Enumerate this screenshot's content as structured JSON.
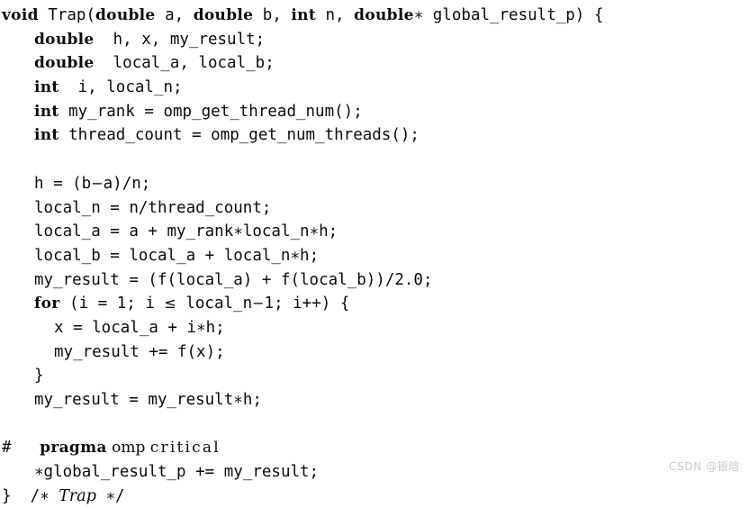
{
  "document": {
    "kind": "code-listing",
    "language": "C with OpenMP",
    "function_name": "Trap",
    "background_color": "#ffffff",
    "text_color": "#0b0b0b",
    "watermark_color": "#c8c8c8"
  },
  "watermark": {
    "text": "CSDN @银晗"
  },
  "code": {
    "lines": [
      {
        "id": "line-1",
        "indent": 0,
        "segments": [
          {
            "t": "void",
            "s": "kw"
          },
          {
            "t": " ",
            "s": "mono"
          },
          {
            "t": "Trap(",
            "s": "mono"
          },
          {
            "t": "double",
            "s": "kw"
          },
          {
            "t": " a, ",
            "s": "mono"
          },
          {
            "t": "double",
            "s": "kw"
          },
          {
            "t": " b, ",
            "s": "mono"
          },
          {
            "t": "int",
            "s": "kw"
          },
          {
            "t": " n, ",
            "s": "mono"
          },
          {
            "t": "double",
            "s": "kw"
          },
          {
            "t": "∗ global_result_p) {",
            "s": "mono"
          }
        ],
        "plain": "void Trap(double a, double b, int n, double* global_result_p) {"
      },
      {
        "id": "line-2",
        "indent": 1,
        "segments": [
          {
            "t": "double",
            "s": "kw"
          },
          {
            "t": "  h, x, my_result;",
            "s": "mono"
          }
        ],
        "plain": "double  h, x, my_result;"
      },
      {
        "id": "line-3",
        "indent": 1,
        "segments": [
          {
            "t": "double",
            "s": "kw"
          },
          {
            "t": "  local_a, local_b;",
            "s": "mono"
          }
        ],
        "plain": "double  local_a, local_b;"
      },
      {
        "id": "line-4",
        "indent": 1,
        "segments": [
          {
            "t": "int",
            "s": "kw"
          },
          {
            "t": "  i, local_n;",
            "s": "mono"
          }
        ],
        "plain": "int  i, local_n;"
      },
      {
        "id": "line-5",
        "indent": 1,
        "segments": [
          {
            "t": "int",
            "s": "kw"
          },
          {
            "t": " my_rank = omp_get_thread_num();",
            "s": "mono"
          }
        ],
        "plain": "int my_rank = omp_get_thread_num();"
      },
      {
        "id": "line-6",
        "indent": 1,
        "segments": [
          {
            "t": "int",
            "s": "kw"
          },
          {
            "t": " thread_count = omp_get_num_threads();",
            "s": "mono"
          }
        ],
        "plain": "int thread_count = omp_get_num_threads();"
      },
      {
        "id": "line-7",
        "indent": 0,
        "blank": true,
        "segments": [],
        "plain": ""
      },
      {
        "id": "line-8",
        "indent": 1,
        "segments": [
          {
            "t": "h = (b",
            "s": "mono"
          },
          {
            "t": "−",
            "s": "op"
          },
          {
            "t": "a)/n;",
            "s": "mono"
          }
        ],
        "plain": "h = (b-a)/n;"
      },
      {
        "id": "line-9",
        "indent": 1,
        "segments": [
          {
            "t": "local_n = n/thread_count;",
            "s": "mono"
          }
        ],
        "plain": "local_n = n/thread_count;"
      },
      {
        "id": "line-10",
        "indent": 1,
        "segments": [
          {
            "t": "local_a = a + my_rank",
            "s": "mono"
          },
          {
            "t": "∗",
            "s": "mono"
          },
          {
            "t": "local_n",
            "s": "mono"
          },
          {
            "t": "∗",
            "s": "mono"
          },
          {
            "t": "h;",
            "s": "mono"
          }
        ],
        "plain": "local_a = a + my_rank*local_n*h;"
      },
      {
        "id": "line-11",
        "indent": 1,
        "segments": [
          {
            "t": "local_b = local_a + local_n",
            "s": "mono"
          },
          {
            "t": "∗",
            "s": "mono"
          },
          {
            "t": "h;",
            "s": "mono"
          }
        ],
        "plain": "local_b = local_a + local_n*h;"
      },
      {
        "id": "line-12",
        "indent": 1,
        "segments": [
          {
            "t": "my_result = (f(local_a) + f(local_b))/2.0;",
            "s": "mono"
          }
        ],
        "plain": "my_result = (f(local_a) + f(local_b))/2.0;"
      },
      {
        "id": "line-13",
        "indent": 1,
        "segments": [
          {
            "t": "for",
            "s": "kw"
          },
          {
            "t": " (i = 1; i ",
            "s": "mono"
          },
          {
            "t": "≤",
            "s": "op"
          },
          {
            "t": " local_n",
            "s": "mono"
          },
          {
            "t": "−",
            "s": "op"
          },
          {
            "t": "1; i++) {",
            "s": "mono"
          }
        ],
        "plain": "for (i = 1; i <= local_n-1; i++) {"
      },
      {
        "id": "line-14",
        "indent": 2,
        "segments": [
          {
            "t": "x = local_a + i",
            "s": "mono"
          },
          {
            "t": "∗",
            "s": "mono"
          },
          {
            "t": "h;",
            "s": "mono"
          }
        ],
        "plain": "x = local_a + i*h;"
      },
      {
        "id": "line-15",
        "indent": 2,
        "segments": [
          {
            "t": "my_result += f(x);",
            "s": "mono"
          }
        ],
        "plain": "my_result += f(x);"
      },
      {
        "id": "line-16",
        "indent": 1,
        "segments": [
          {
            "t": "}",
            "s": "mono"
          }
        ],
        "plain": "}"
      },
      {
        "id": "line-17",
        "indent": 1,
        "segments": [
          {
            "t": "my_result = my_result",
            "s": "mono"
          },
          {
            "t": "∗",
            "s": "mono"
          },
          {
            "t": "h;",
            "s": "mono"
          }
        ],
        "plain": "my_result = my_result*h;"
      },
      {
        "id": "line-18",
        "indent": 0,
        "blank": true,
        "segments": [],
        "plain": ""
      },
      {
        "id": "line-19",
        "indent": 0,
        "segments": [
          {
            "t": "#",
            "s": "mono"
          },
          {
            "t": "   ",
            "s": "mono"
          },
          {
            "t": "pragma",
            "s": "kw"
          },
          {
            "t": " ",
            "s": "rm"
          },
          {
            "t": "omp",
            "s": "rm"
          },
          {
            "t": " ",
            "s": "rm"
          },
          {
            "t": "critical",
            "s": "rm-wide"
          }
        ],
        "plain": "#   pragma omp critical"
      },
      {
        "id": "line-20",
        "indent": 1,
        "segments": [
          {
            "t": "∗",
            "s": "mono"
          },
          {
            "t": "global_result_p += my_result;",
            "s": "mono"
          }
        ],
        "plain": "*global_result_p += my_result;"
      },
      {
        "id": "line-21",
        "indent": 0,
        "segments": [
          {
            "t": "}  /",
            "s": "mono"
          },
          {
            "t": "∗",
            "s": "mono"
          },
          {
            "t": " ",
            "s": "mono"
          },
          {
            "t": "Trap",
            "s": "it"
          },
          {
            "t": " ",
            "s": "mono"
          },
          {
            "t": "∗",
            "s": "mono"
          },
          {
            "t": "/",
            "s": "mono"
          }
        ],
        "plain": "}  /* Trap */"
      }
    ]
  }
}
